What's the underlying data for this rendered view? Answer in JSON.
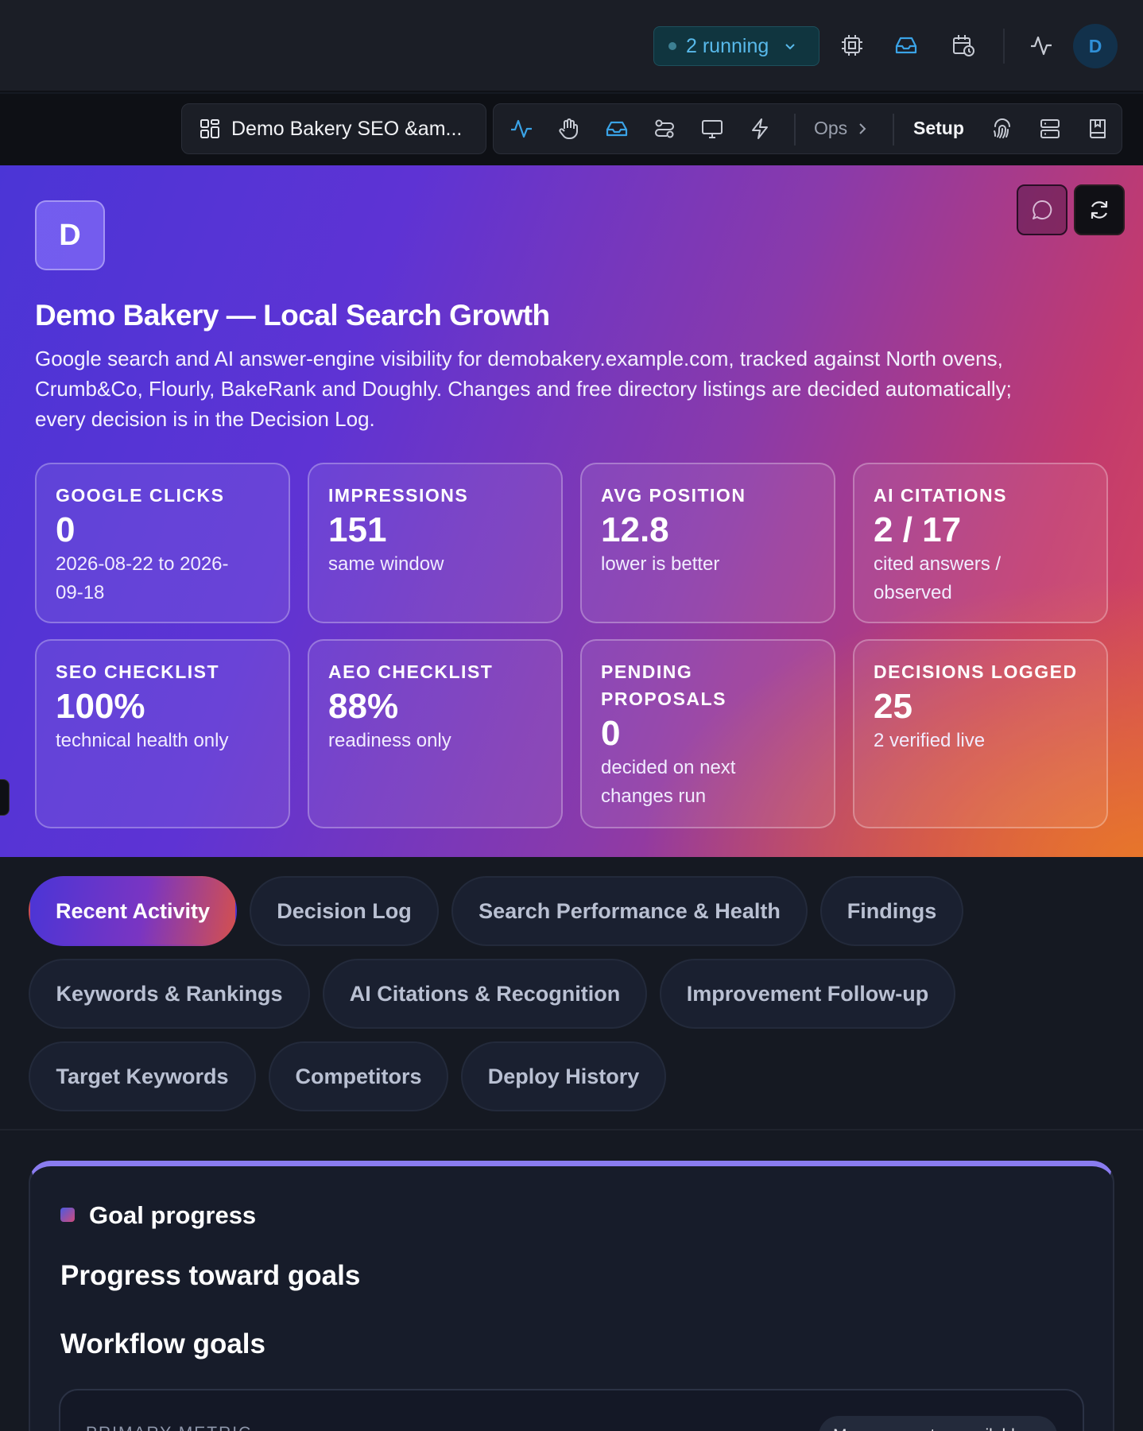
{
  "topbar": {
    "running_label": "2 running",
    "avatar_initial": "D",
    "icons": [
      "cpu-icon",
      "inbox-icon",
      "calendar-clock-icon",
      "activity-icon"
    ]
  },
  "toolbar": {
    "project_name": "Demo Bakery SEO &am...",
    "ops_label": "Ops",
    "setup_label": "Setup",
    "icons": [
      "activity-icon",
      "hand-icon",
      "inbox-icon",
      "workflow-icon",
      "monitor-icon",
      "bolt-icon",
      "fingerprint-icon",
      "server-icon",
      "book-icon"
    ]
  },
  "hero": {
    "avatar_initial": "D",
    "title": "Demo Bakery — Local Search Growth",
    "description_line1": "Google search and AI answer-engine visibility for demobakery.example.com, tracked against North ovens,",
    "description_line2": "Crumb&Co, Flourly, BakeRank and Doughly. Changes and free directory listings are decided automatically;",
    "description_line3": "every decision is in the Decision Log.",
    "stats": [
      {
        "label": "GOOGLE CLICKS",
        "value": "0",
        "sub1": "2026-08-22 to 2026-",
        "sub2": "09-18"
      },
      {
        "label": "IMPRESSIONS",
        "value": "151",
        "sub1": "same window",
        "sub2": ""
      },
      {
        "label": "AVG POSITION",
        "value": "12.8",
        "sub1": "lower is better",
        "sub2": ""
      },
      {
        "label": "AI CITATIONS",
        "value": "2 / 17",
        "sub1": "cited answers /",
        "sub2": "observed"
      },
      {
        "label": "SEO CHECKLIST",
        "value": "100%",
        "sub1": "technical health only",
        "sub2": ""
      },
      {
        "label": "AEO CHECKLIST",
        "value": "88%",
        "sub1": "readiness only",
        "sub2": ""
      },
      {
        "label1": "PENDING",
        "label2": "PROPOSALS",
        "value": "0",
        "sub1": "decided on next",
        "sub2": "changes run"
      },
      {
        "label": "DECISIONS LOGGED",
        "value": "25",
        "sub1": "2 verified live",
        "sub2": ""
      }
    ]
  },
  "tabs": [
    "Recent Activity",
    "Decision Log",
    "Search Performance & Health",
    "Findings",
    "Keywords & Rankings",
    "AI Citations & Recognition",
    "Improvement Follow-up",
    "Target Keywords",
    "Competitors",
    "Deploy History"
  ],
  "goals": {
    "section_label": "Goal progress",
    "heading": "Progress toward goals",
    "subheading": "Workflow goals",
    "metric_label": "PRIMARY METRIC",
    "metric_status": "Measurement unavailable"
  },
  "colors": {
    "accent": "#5e33d4",
    "running": "#58b9ea",
    "hero_end": "#e87828"
  }
}
